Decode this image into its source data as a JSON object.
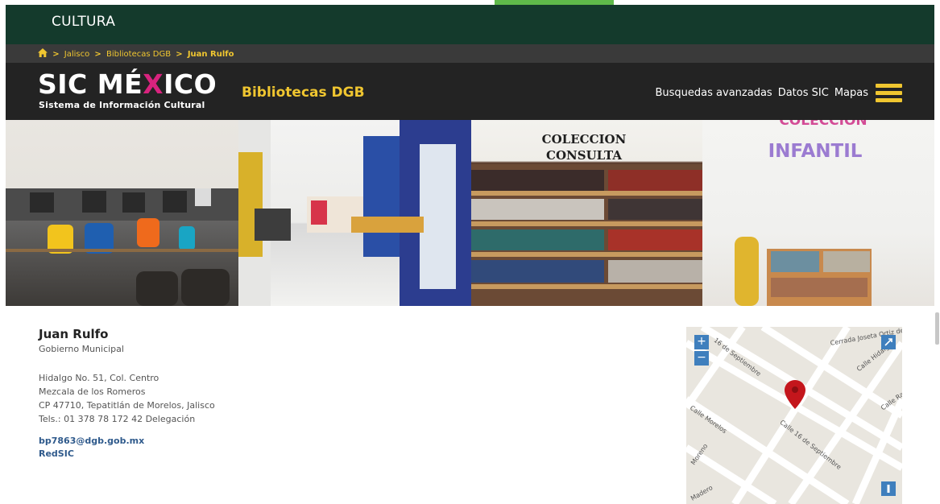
{
  "topbar": {
    "title": "CULTURA"
  },
  "breadcrumb": {
    "items": [
      "Jalisco",
      "Bibliotecas DGB",
      "Juan Rulfo"
    ],
    "separator": ">"
  },
  "header": {
    "logo_part1": "SIC M",
    "logo_accent_a": "É",
    "logo_accent_x": "X",
    "logo_part2": "ICO",
    "logo_subtitle": "Sistema de Información Cultural",
    "section": "Bibliotecas DGB",
    "nav": [
      "Busquedas avanzadas",
      "Datos SIC",
      "Mapas"
    ],
    "menu_icon": "hamburger-icon"
  },
  "banner": {
    "texts": [
      "COLECCION",
      "CONSULTA",
      "COLECCION",
      "INFANTIL"
    ]
  },
  "library": {
    "name": "Juan Rulfo",
    "type": "Gobierno Municipal",
    "address_line1": "Hidalgo No. 51, Col. Centro",
    "address_line2": "Mezcala de los Romeros",
    "address_line3": "CP 47710, Tepatitlán de Morelos, Jalisco",
    "phone": "Tels.: 01 378 78 172 42 Delegación",
    "email": "bp7863@dgb.gob.mx",
    "link": "RedSIC"
  },
  "map": {
    "zoom_in": "+",
    "zoom_out": "−",
    "streets": [
      "16 de Septiembre",
      "Cerrada Joseta Ortiz de Domínguez",
      "Calle Hidalgo",
      "Calle Morelos",
      "Calle 16 de Septiembre",
      "Calle Ra",
      "Moreno",
      "Madero"
    ],
    "marker_color": "#c4161c",
    "control_color": "#3f7fbd"
  },
  "colors": {
    "topbar": "#143a2c",
    "header": "#232323",
    "accent": "#f0c630",
    "logo_accent": "#d8237e",
    "link": "#2f5a8c"
  }
}
